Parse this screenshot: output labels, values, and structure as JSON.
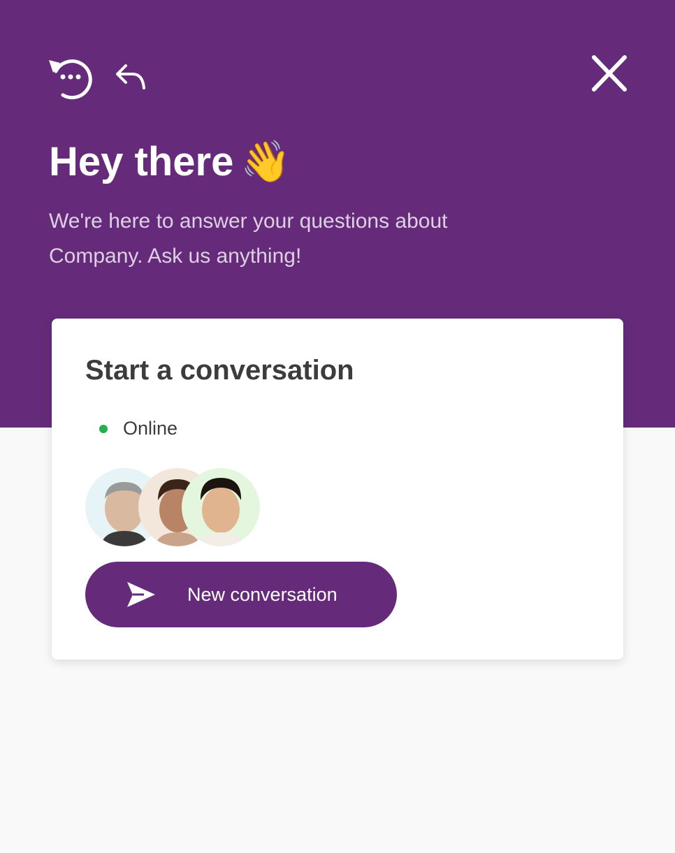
{
  "header": {
    "greeting": "Hey there",
    "greeting_emoji": "👋",
    "subtitle": "We're here to answer your questions about Company. Ask us anything!",
    "icons": {
      "history": "history-icon",
      "back": "back-icon",
      "close": "close-icon"
    }
  },
  "card": {
    "title": "Start a conversation",
    "status": {
      "label": "Online",
      "color": "#22b14c"
    },
    "avatars": [
      "avatar",
      "avatar",
      "avatar"
    ],
    "new_conversation": {
      "label": "New conversation",
      "icon": "send-icon"
    }
  },
  "colors": {
    "brand": "#652b7a",
    "background": "#f9f9f9",
    "card": "#ffffff",
    "online": "#22b14c"
  }
}
